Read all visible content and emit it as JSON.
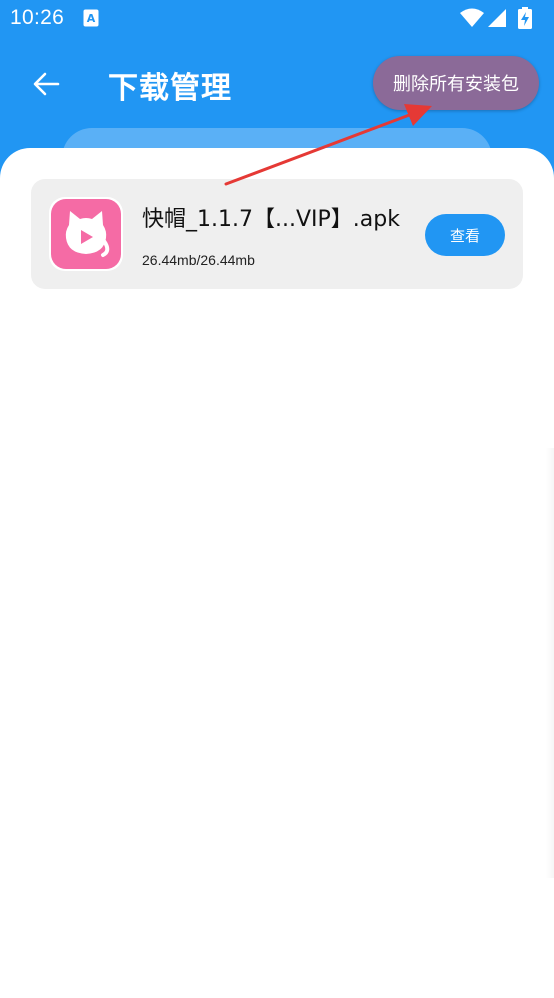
{
  "status_bar": {
    "time": "10:26",
    "app_icon": "a-letter-icon",
    "indicators": [
      "wifi-icon",
      "signal-icon",
      "battery-charging-icon"
    ]
  },
  "header": {
    "back_icon": "back-arrow-icon",
    "title": "下载管理",
    "delete_all_label": "删除所有安装包"
  },
  "downloads": [
    {
      "icon": "pink-cat-play-icon",
      "file_name": "快帽_1.1.7【...VIP】.apk",
      "size_progress": "26.44mb/26.44mb",
      "view_label": "查看"
    }
  ],
  "colors": {
    "primary": "#2196f3",
    "delete_button": "#8b6a98",
    "card": "#efefef",
    "app_icon": "#f56ba5",
    "annotation_arrow": "#e53935"
  }
}
